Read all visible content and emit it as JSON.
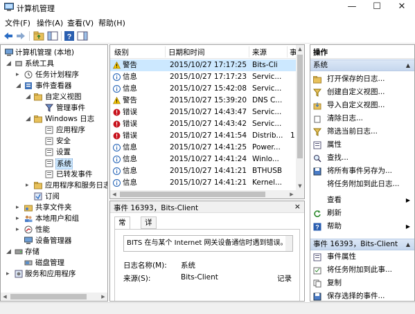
{
  "window": {
    "title": "计算机管理"
  },
  "menu": {
    "file": "文件(F)",
    "action": "操作(A)",
    "view": "查看(V)",
    "help": "帮助(H)"
  },
  "tree": {
    "root": "计算机管理 (本地)",
    "system_tools": "系统工具",
    "task_scheduler": "任务计划程序",
    "event_viewer": "事件查看器",
    "custom_views": "自定义视图",
    "admin_events": "管理事件",
    "windows_logs": "Windows 日志",
    "application": "应用程序",
    "security": "安全",
    "setup": "设置",
    "system": "系统",
    "forwarded": "已转发事件",
    "app_services_logs": "应用程序和服务日志",
    "subscriptions": "订阅",
    "shared_folders": "共享文件夹",
    "local_users": "本地用户和组",
    "performance": "性能",
    "device_manager": "设备管理器",
    "storage": "存储",
    "disk_management": "磁盘管理",
    "services_apps": "服务和应用程序"
  },
  "events": {
    "headers": {
      "level": "级别",
      "datetime": "日期和时间",
      "source": "来源",
      "event": "事"
    },
    "rows": [
      {
        "level": "警告",
        "type": "warning",
        "datetime": "2015/10/27 17:17:25",
        "source": "Bits-Cli",
        "extra": ""
      },
      {
        "level": "信息",
        "type": "info",
        "datetime": "2015/10/27 17:17:23",
        "source": "Servic...",
        "extra": ""
      },
      {
        "level": "信息",
        "type": "info",
        "datetime": "2015/10/27 15:42:08",
        "source": "Servic...",
        "extra": ""
      },
      {
        "level": "警告",
        "type": "warning",
        "datetime": "2015/10/27 15:39:20",
        "source": "DNS C...",
        "extra": ""
      },
      {
        "level": "错误",
        "type": "error",
        "datetime": "2015/10/27 14:43:47",
        "source": "Servic...",
        "extra": ""
      },
      {
        "level": "错误",
        "type": "error",
        "datetime": "2015/10/27 14:43:42",
        "source": "Servic...",
        "extra": ""
      },
      {
        "level": "错误",
        "type": "error",
        "datetime": "2015/10/27 14:41:54",
        "source": "Distrib...",
        "extra": "1"
      },
      {
        "level": "信息",
        "type": "info",
        "datetime": "2015/10/27 14:41:25",
        "source": "Power...",
        "extra": ""
      },
      {
        "level": "信息",
        "type": "info",
        "datetime": "2015/10/27 14:41:24",
        "source": "Winlo...",
        "extra": ""
      },
      {
        "level": "信息",
        "type": "info",
        "datetime": "2015/10/27 14:41:21",
        "source": "BTHUSB",
        "extra": ""
      },
      {
        "level": "信息",
        "type": "info",
        "datetime": "2015/10/27 14:41:21",
        "source": "Kernel...",
        "extra": ""
      }
    ]
  },
  "detail": {
    "title": "事件 16393，Bits-Client",
    "close": "×",
    "tab_general": "常规",
    "tab_details": "详细信息",
    "message": "BITS 在与某个 Internet 网关设备通信时遇到错误。请检",
    "log_name_label": "日志名称(M):",
    "log_name_value": "系统",
    "source_label": "来源(S):",
    "source_value": "Bits-Client",
    "logged_label": "记录"
  },
  "actions": {
    "title": "操作",
    "group_system": "系统",
    "group_event": "事件 16393，Bits-Client",
    "items": [
      {
        "label": "打开保存的日志...",
        "icon": "open-folder-icon"
      },
      {
        "label": "创建自定义视图...",
        "icon": "filter-icon"
      },
      {
        "label": "导入自定义视图...",
        "icon": "import-icon"
      },
      {
        "label": "清除日志...",
        "icon": "clear-icon"
      },
      {
        "label": "筛选当前日志...",
        "icon": "filter-icon"
      },
      {
        "label": "属性",
        "icon": "properties-icon"
      },
      {
        "label": "查找...",
        "icon": "find-icon"
      },
      {
        "label": "将所有事件另存为...",
        "icon": "save-icon"
      },
      {
        "label": "将任务附加到此日志...",
        "icon": ""
      },
      {
        "label": "查看",
        "icon": ""
      },
      {
        "label": "刷新",
        "icon": "refresh-icon"
      },
      {
        "label": "帮助",
        "icon": "help-icon"
      }
    ],
    "event_items": [
      {
        "label": "事件属性",
        "icon": "properties-icon"
      },
      {
        "label": "将任务附加到此事...",
        "icon": "task-icon"
      },
      {
        "label": "复制",
        "icon": "copy-icon"
      },
      {
        "label": "保存选择的事件...",
        "icon": "save-icon"
      }
    ]
  },
  "colors": {
    "selection": "#cce8ff",
    "group_header": "#c6d7ee",
    "warning": "#f2c200",
    "error": "#c8141e",
    "info": "#1e5fb4"
  }
}
